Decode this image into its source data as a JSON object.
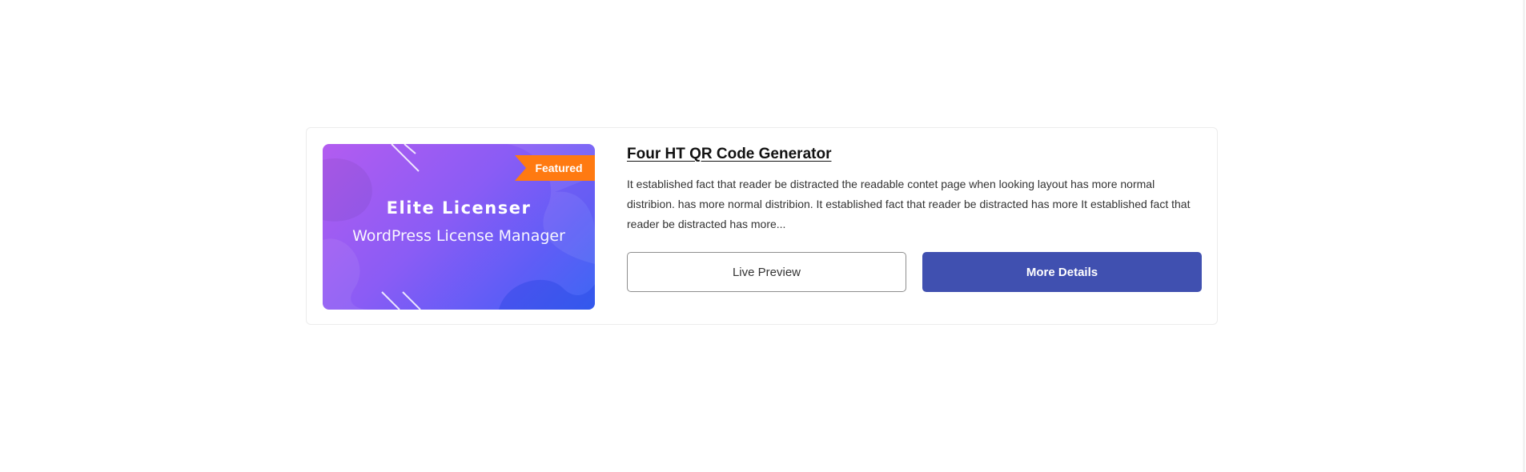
{
  "product": {
    "title": "Four HT QR Code Generator",
    "description": "It established fact that reader be distracted the readable contet page when looking layout has more normal distribion. has more normal distribion. It established fact that reader be distracted has more It established fact that reader be distracted has more...",
    "badge": "Featured",
    "thumbnail": {
      "title": "Elite Licenser",
      "subtitle": "WordPress License Manager"
    },
    "actions": {
      "live_preview": "Live Preview",
      "more_details": "More Details"
    }
  },
  "colors": {
    "badge": "#ff7a11",
    "primary_button": "#4050b0",
    "thumbnail_gradient_start": "#b35cf0",
    "thumbnail_gradient_end": "#3d67f4"
  }
}
